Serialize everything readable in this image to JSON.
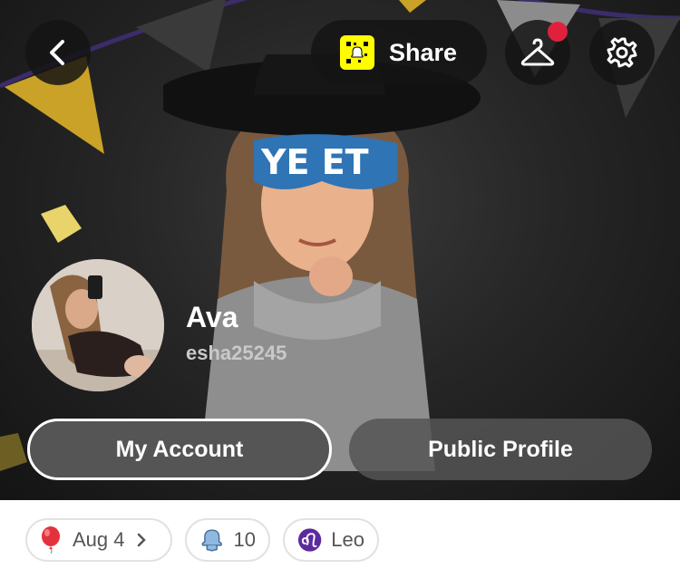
{
  "header": {
    "share_label": "Share",
    "colors": {
      "snap_yellow": "#fffc00",
      "notification": "#e0213b"
    }
  },
  "avatar": {
    "glasses_text": "YE ET"
  },
  "profile": {
    "display_name": "Ava",
    "username": "esha25245"
  },
  "actions": {
    "my_account": "My Account",
    "public_profile": "Public Profile"
  },
  "chips": {
    "birthday": {
      "icon": "balloon-icon",
      "label": "Aug 4"
    },
    "friends": {
      "icon": "ghost-icon",
      "label": "10"
    },
    "zodiac": {
      "icon": "leo-icon",
      "label": "Leo"
    }
  }
}
